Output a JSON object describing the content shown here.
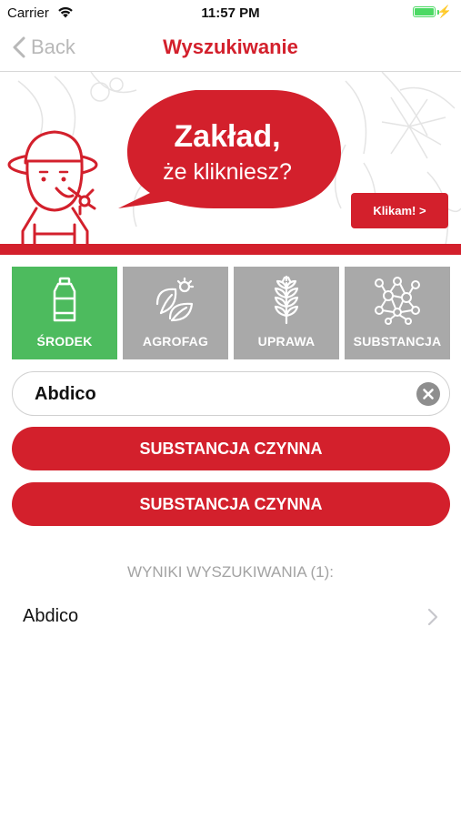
{
  "status_bar": {
    "carrier": "Carrier",
    "time": "11:57 PM",
    "battery_level": 1.0
  },
  "nav": {
    "back_label": "Back",
    "title": "Wyszukiwanie"
  },
  "banner": {
    "headline": "Zakład,",
    "subline": "że klikniesz?",
    "button_label": "Klikam! >"
  },
  "categories": [
    {
      "label": "ŚRODEK",
      "icon": "bottle-icon",
      "active": true
    },
    {
      "label": "AGROFAG",
      "icon": "leaf-pest-icon",
      "active": false
    },
    {
      "label": "UPRAWA",
      "icon": "wheat-icon",
      "active": false
    },
    {
      "label": "SUBSTANCJA",
      "icon": "molecule-icon",
      "active": false
    }
  ],
  "search": {
    "value": "Abdico"
  },
  "buttons": {
    "first_label": "SUBSTANCJA CZYNNA",
    "second_label": "SUBSTANCJA CZYNNA"
  },
  "results": {
    "header": "WYNIKI WYSZUKIWANIA (1):",
    "items": [
      {
        "name": "Abdico"
      }
    ]
  },
  "colors": {
    "brand_red": "#d3202c",
    "active_green": "#4dbb5e",
    "inactive_gray": "#a9a9a9"
  }
}
